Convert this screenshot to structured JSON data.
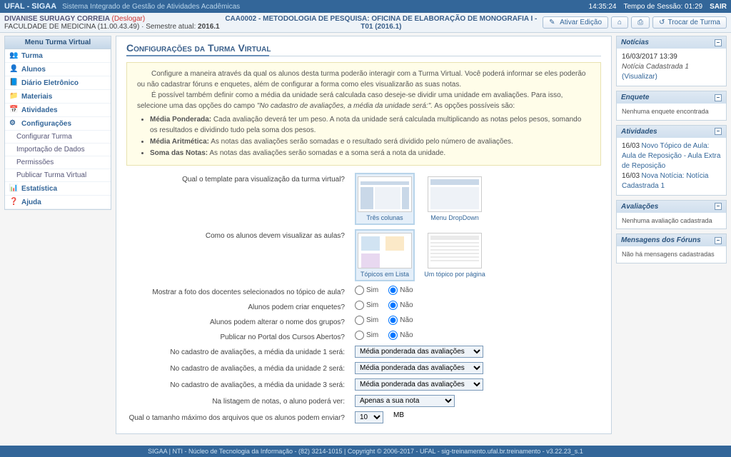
{
  "topbar": {
    "app": "UFAL - SIGAA",
    "subtitle": "Sistema Integrado de Gestão de Atividades Acadêmicas",
    "time": "14:35:24",
    "session": "Tempo de Sessão: 01:29",
    "exit": "SAIR"
  },
  "userbar": {
    "name": "DIVANISE SURUAGY CORREIA",
    "logout": "(Deslogar)",
    "sub": "FACULDADE DE MEDICINA (11.00.43.49) · Semestre atual: ",
    "sem": "2016.1",
    "course": "CAA0002 - METODOLOGIA DE PESQUISA: OFICINA DE ELABORAÇÃO DE MONOGRAFIA I - T01 (2016.1)",
    "btn_edit": "Ativar Edição",
    "btn_switch": "Trocar de Turma"
  },
  "menu": {
    "title": "Menu Turma Virtual",
    "items": [
      {
        "l": "Turma",
        "s": true
      },
      {
        "l": "Alunos",
        "s": true
      },
      {
        "l": "Diário Eletrônico",
        "s": true
      },
      {
        "l": "Materiais",
        "s": true
      },
      {
        "l": "Atividades",
        "s": true
      },
      {
        "l": "Configurações",
        "s": true
      },
      {
        "l": "Configurar Turma",
        "s": false
      },
      {
        "l": "Importação de Dados",
        "s": false
      },
      {
        "l": "Permissões",
        "s": false
      },
      {
        "l": "Publicar Turma Virtual",
        "s": false
      },
      {
        "l": "Estatística",
        "s": true
      },
      {
        "l": "Ajuda",
        "s": true
      }
    ]
  },
  "page": {
    "title": "Configurações da Turma Virtual",
    "info_p1": "Configure a maneira através da qual os alunos desta turma poderão interagir com a Turma Virtual. Você poderá informar se eles poderão ou não cadastrar fóruns e enquetes, além de configurar a forma como eles visualizarão as suas notas.",
    "info_p2a": "É possível também definir como a média da unidade será calculada caso deseje-se dividir uma unidade em avaliações. Para isso, selecione uma das opções do campo ",
    "info_p2b": "\"No cadastro de avaliações, a média da unidade será:\".",
    "info_p2c": " As opções possíveis são:",
    "b1": "Média Ponderada:",
    "b1t": " Cada avaliação deverá ter um peso. A nota da unidade será calculada multiplicando as notas pelos pesos, somando os resultados e dividindo tudo pela soma dos pesos.",
    "b2": "Média Aritmética:",
    "b2t": " As notas das avaliações serão somadas e o resultado será dividido pelo número de avaliações.",
    "b3": "Soma das Notas:",
    "b3t": " As notas das avaliações serão somadas e a soma será a nota da unidade.",
    "q_template": "Qual o template para visualização da turma virtual?",
    "tpl1": "Três colunas",
    "tpl2": "Menu DropDown",
    "q_view": "Como os alunos devem visualizar as aulas?",
    "tpl3": "Tópicos em Lista",
    "tpl4": "Um tópico por página",
    "q_photo": "Mostrar a foto dos docentes selecionados no tópico de aula?",
    "q_poll": "Alunos podem criar enquetes?",
    "q_group": "Alunos podem alterar o nome dos grupos?",
    "q_portal": "Publicar no Portal dos Cursos Abertos?",
    "yes": "Sim",
    "no": "Não",
    "q_u1": "No cadastro de avaliações, a média da unidade 1 será:",
    "q_u2": "No cadastro de avaliações, a média da unidade 2 será:",
    "q_u3": "No cadastro de avaliações, a média da unidade 3 será:",
    "sel_avg": "Média ponderada das avaliações",
    "q_notas": "Na listagem de notas, o aluno poderá ver:",
    "sel_notas": "Apenas a sua nota",
    "q_size": "Qual o tamanho máximo dos arquivos que os alunos podem enviar?",
    "sel_size": "10",
    "mb": "MB"
  },
  "side": {
    "noticias": {
      "t": "Notícias",
      "date": "16/03/2017 13:39",
      "text": "Notícia Cadastrada 1",
      "link": "(Visualizar)"
    },
    "enquete": {
      "t": "Enquete",
      "body": "Nenhuma enquete encontrada"
    },
    "atividades": {
      "t": "Atividades",
      "i1d": "16/03",
      "i1": "Novo Tópico de Aula: Aula de Reposição - Aula Extra de Reposição",
      "i2d": "16/03",
      "i2": "Nova Notícia: Notícia Cadastrada 1"
    },
    "avaliacoes": {
      "t": "Avaliações",
      "body": "Nenhuma avaliação cadastrada"
    },
    "foruns": {
      "t": "Mensagens dos Fóruns",
      "body": "Não há mensagens cadastradas"
    }
  },
  "footer": "SIGAA | NTI - Núcleo de Tecnologia da Informação - (82) 3214-1015 | Copyright © 2006-2017 - UFAL - sig-treinamento.ufal.br.treinamento - v3.22.23_s.1"
}
